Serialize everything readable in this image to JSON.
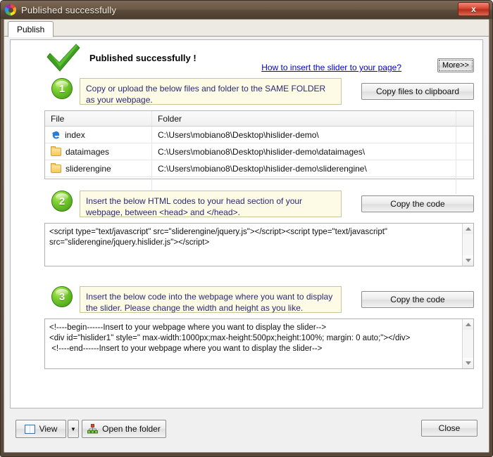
{
  "window": {
    "title": "Published successfully",
    "icon": "color-wheel-icon",
    "close_label": "x"
  },
  "tabs": [
    {
      "label": "Publish",
      "active": true
    }
  ],
  "header": {
    "icon": "green-checkmark-icon",
    "title": "Published successfully !",
    "help_link": "How to insert the slider to your page?",
    "more_button": "More>>"
  },
  "steps": [
    {
      "number": "1",
      "instruction": "Copy or upload the below files and folder to the SAME FOLDER as your webpage.",
      "button": "Copy files to clipboard"
    },
    {
      "number": "2",
      "instruction": "Insert  the below HTML codes to your head section of your webpage, between <head> and </head>.",
      "button": "Copy the code",
      "code": "<script type=\"text/javascript\" src=\"sliderengine/jquery.js\"></script><script type=\"text/javascript\" src=\"sliderengine/jquery.hislider.js\"></script>"
    },
    {
      "number": "3",
      "instruction": "Insert the below code into the webpage where you want to display the slider. Please change the width and height as you like.",
      "button": "Copy the code",
      "code": "<!----begin------Insert to your webpage where you want to display the slider-->\n<div id=\"hislider1\" style=\" max-width:1000px;max-height:500px;height:100%; margin: 0 auto;\"></div>\n <!----end------Insert to your webpage where you want to display the slider-->"
    }
  ],
  "file_table": {
    "columns": [
      "File",
      "Folder"
    ],
    "rows": [
      {
        "icon": "internet-explorer-icon",
        "file": "index",
        "folder": "C:\\Users\\mobiano8\\Desktop\\hislider-demo\\"
      },
      {
        "icon": "folder-icon",
        "file": "dataimages",
        "folder": "C:\\Users\\mobiano8\\Desktop\\hislider-demo\\dataimages\\"
      },
      {
        "icon": "folder-icon",
        "file": "sliderengine",
        "folder": "C:\\Users\\mobiano8\\Desktop\\hislider-demo\\sliderengine\\"
      }
    ]
  },
  "footer": {
    "view_button": "View",
    "view_dropdown": "▼",
    "open_folder_button": "Open the folder",
    "close_button": "Close"
  },
  "colors": {
    "titlebar": "#5b4b3b",
    "accent_green": "#72c82a",
    "link": "#0000cc",
    "note_bg": "#fdfae5",
    "note_text": "#2a2a75",
    "close_red": "#d5462f"
  }
}
